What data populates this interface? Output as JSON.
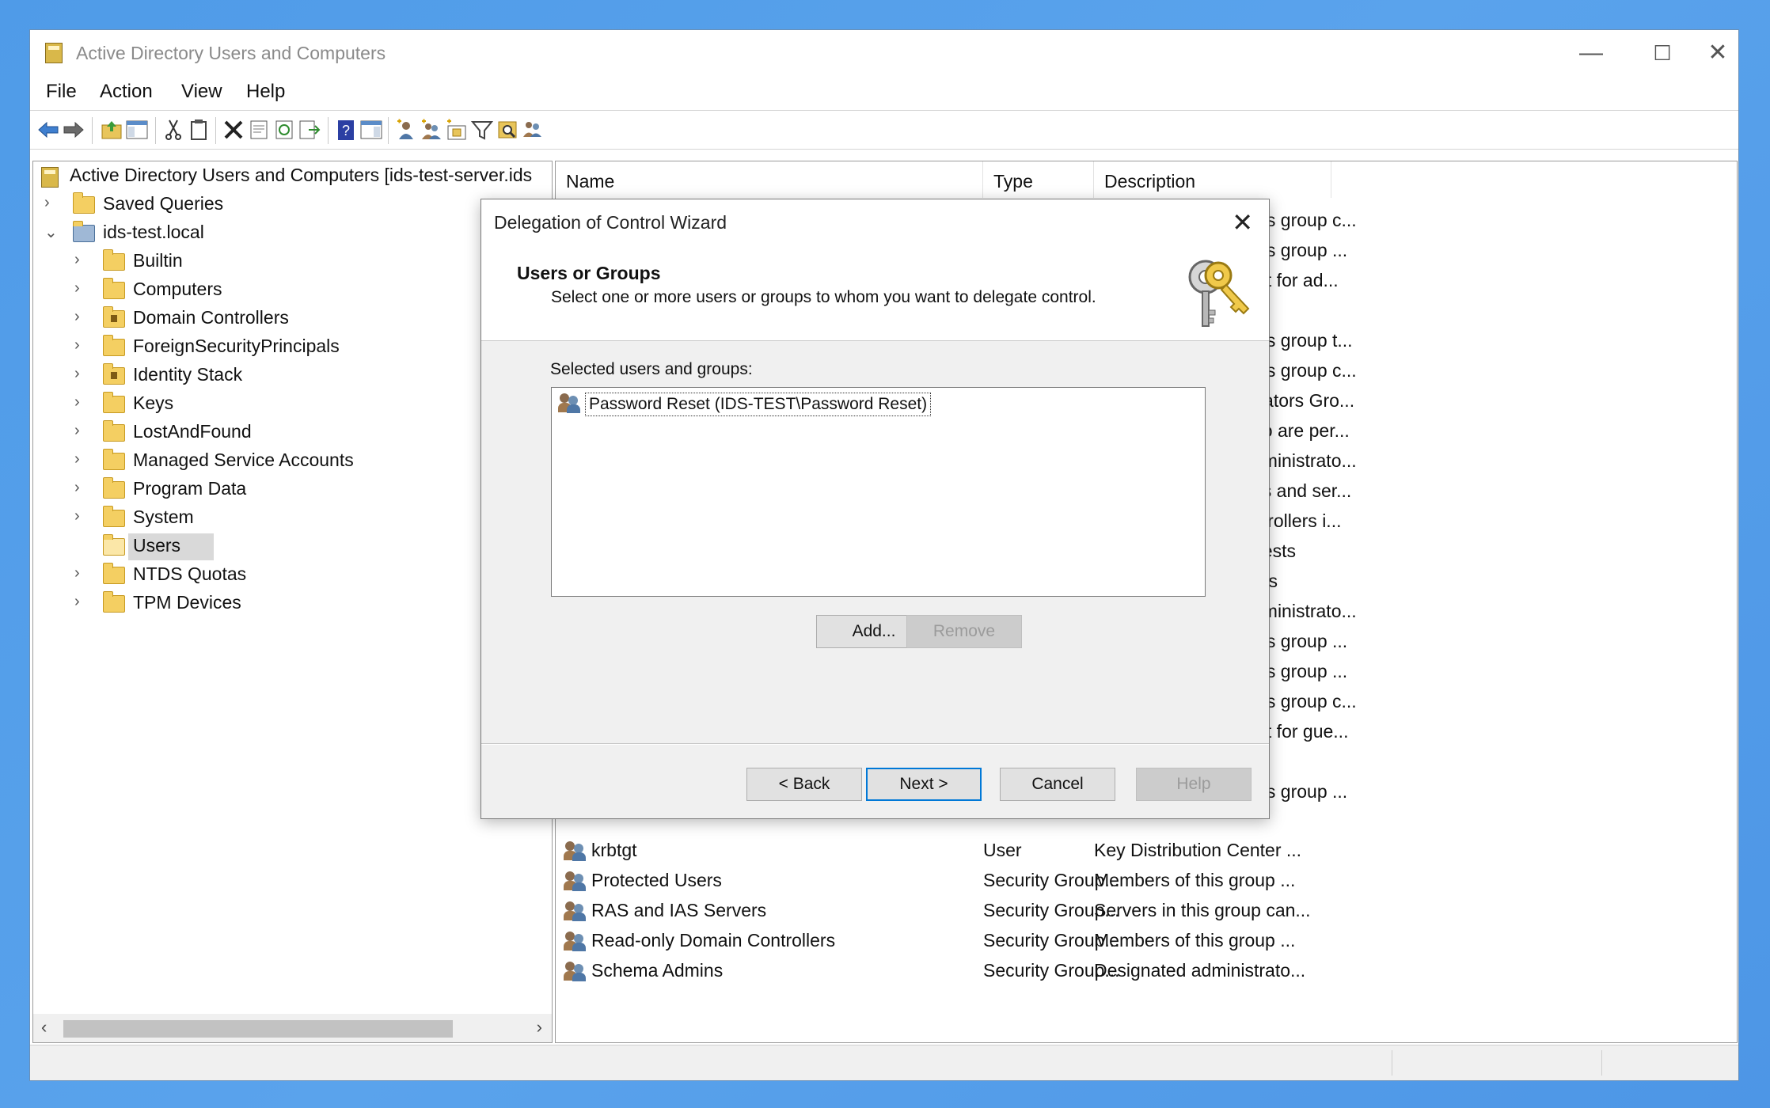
{
  "window": {
    "title": "Active Directory Users and Computers",
    "controls": {
      "minimize": "—",
      "maximize": "☐",
      "close": "✕"
    }
  },
  "menu": [
    "File",
    "Action",
    "View",
    "Help"
  ],
  "toolbar": {
    "icons": [
      "back-icon",
      "forward-icon",
      "up-folder-icon",
      "show-hide-console-tree-icon",
      "cut-icon",
      "copy-icon",
      "delete-icon",
      "properties-icon",
      "refresh-icon",
      "export-list-icon",
      "help-icon",
      "action-pane-icon",
      "new-user-icon",
      "new-group-icon",
      "new-ou-icon",
      "filter-icon",
      "find-icon",
      "add-to-group-icon"
    ]
  },
  "tree": {
    "root": "Active Directory Users and Computers [ids-test-server.ids",
    "items": [
      {
        "label": "Saved Queries",
        "level": 1,
        "expander": "›"
      },
      {
        "label": "ids-test.local",
        "level": 1,
        "expander": "⌄"
      },
      {
        "label": "Builtin",
        "level": 2,
        "expander": "›"
      },
      {
        "label": "Computers",
        "level": 2,
        "expander": "›"
      },
      {
        "label": "Domain Controllers",
        "level": 2,
        "expander": "›"
      },
      {
        "label": "ForeignSecurityPrincipals",
        "level": 2,
        "expander": "›"
      },
      {
        "label": "Identity Stack",
        "level": 2,
        "expander": "›"
      },
      {
        "label": "Keys",
        "level": 2,
        "expander": "›"
      },
      {
        "label": "LostAndFound",
        "level": 2,
        "expander": "›"
      },
      {
        "label": "Managed Service Accounts",
        "level": 2,
        "expander": "›"
      },
      {
        "label": "Program Data",
        "level": 2,
        "expander": "›"
      },
      {
        "label": "System",
        "level": 2,
        "expander": "›"
      },
      {
        "label": "Users",
        "level": 2,
        "expander": ""
      },
      {
        "label": "NTDS Quotas",
        "level": 2,
        "expander": "›"
      },
      {
        "label": "TPM Devices",
        "level": 2,
        "expander": "›"
      }
    ],
    "scroll_left": "‹",
    "scroll_right": "›"
  },
  "list": {
    "columns": [
      "Name",
      "Type",
      "Description"
    ],
    "partial_descriptions": [
      "his group c...",
      "his group ...",
      "int for ad...",
      "",
      "his group t...",
      "his group c...",
      "trators Gro...",
      "ho are per...",
      "dministrato...",
      "ns and ser...",
      "ntrollers i...",
      "uests",
      "ers",
      "dministrato...",
      "his group ...",
      "his group ...",
      "his group c...",
      "int for gue...",
      "",
      "his group ..."
    ],
    "rows": [
      {
        "name": "krbtgt",
        "type": "User",
        "description": "Key Distribution Center ..."
      },
      {
        "name": "Protected Users",
        "type": "Security Group...",
        "description": "Members of this group ..."
      },
      {
        "name": "RAS and IAS Servers",
        "type": "Security Group...",
        "description": "Servers in this group can..."
      },
      {
        "name": "Read-only Domain Controllers",
        "type": "Security Group...",
        "description": "Members of this group ..."
      },
      {
        "name": "Schema Admins",
        "type": "Security Group...",
        "description": "Designated administrato..."
      }
    ]
  },
  "dialog": {
    "title": "Delegation of Control Wizard",
    "close": "✕",
    "heading": "Users or Groups",
    "subheading": "Select one or more users or groups to whom you want to delegate control.",
    "list_label": "Selected users and groups:",
    "selected": [
      "Password Reset (IDS-TEST\\Password Reset)"
    ],
    "buttons": {
      "add": "Add...",
      "remove": "Remove",
      "back": "< Back",
      "next": "Next >",
      "cancel": "Cancel",
      "help": "Help"
    }
  }
}
